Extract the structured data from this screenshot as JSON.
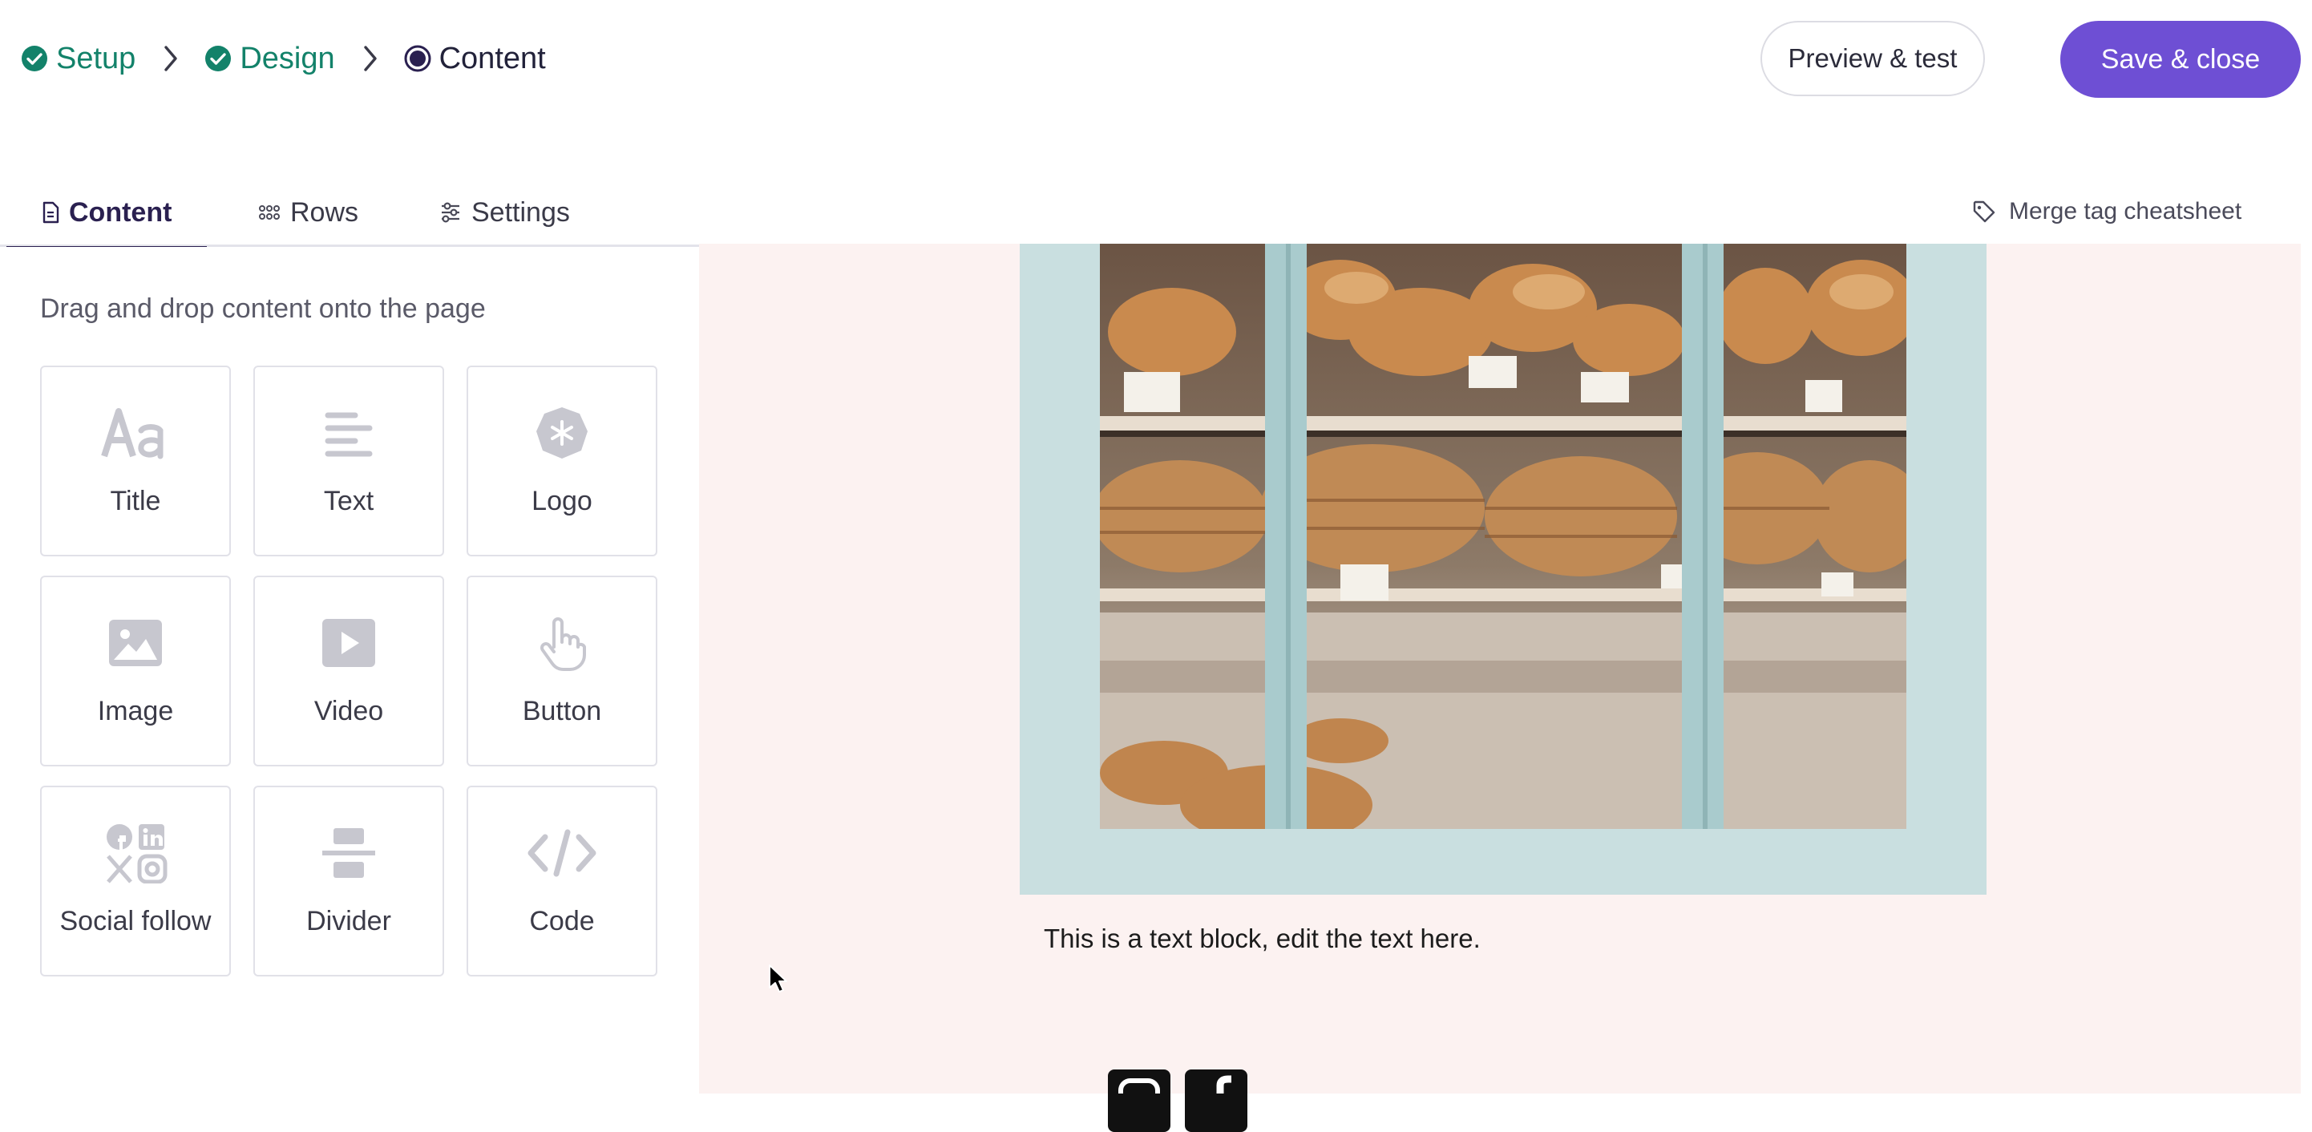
{
  "steps": [
    {
      "label": "Setup",
      "state": "done"
    },
    {
      "label": "Design",
      "state": "done"
    },
    {
      "label": "Content",
      "state": "current"
    }
  ],
  "header": {
    "preview_label": "Preview & test",
    "save_label": "Save & close"
  },
  "tabs": [
    {
      "label": "Content",
      "icon": "document-icon",
      "active": true
    },
    {
      "label": "Rows",
      "icon": "grid-dots-icon",
      "active": false
    },
    {
      "label": "Settings",
      "icon": "sliders-icon",
      "active": false
    }
  ],
  "merge_tag_label": "Merge tag cheatsheet",
  "panel": {
    "hint": "Drag and drop content onto the page",
    "blocks": [
      {
        "label": "Title",
        "icon": "title-icon"
      },
      {
        "label": "Text",
        "icon": "text-lines-icon"
      },
      {
        "label": "Logo",
        "icon": "logo-badge-icon"
      },
      {
        "label": "Image",
        "icon": "image-icon"
      },
      {
        "label": "Video",
        "icon": "video-play-icon"
      },
      {
        "label": "Button",
        "icon": "pointer-hand-icon"
      },
      {
        "label": "Social follow",
        "icon": "social-icons-icon"
      },
      {
        "label": "Divider",
        "icon": "divider-icon"
      },
      {
        "label": "Code",
        "icon": "code-brackets-icon"
      }
    ]
  },
  "canvas": {
    "text_block": "This is a text block, edit the text here.",
    "social_icons": [
      "instagram-icon",
      "facebook-icon"
    ]
  },
  "colors": {
    "accent": "#6e4fd4",
    "done_green": "#13826a",
    "canvas_bg": "#fcf2f1",
    "image_frame": "#c9dfe0"
  }
}
